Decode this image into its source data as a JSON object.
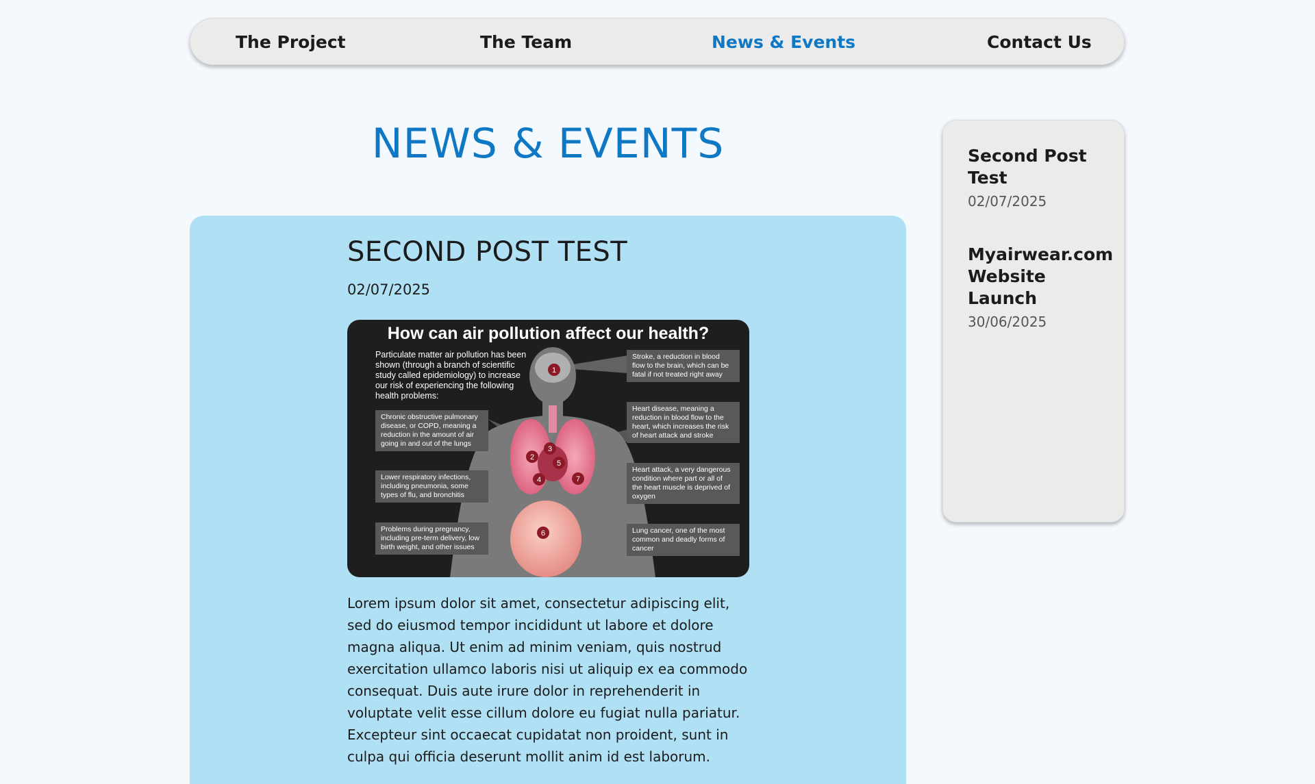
{
  "nav": {
    "items": [
      {
        "label": "The Project"
      },
      {
        "label": "The Team"
      },
      {
        "label": "News & Events"
      },
      {
        "label": "Contact Us"
      }
    ]
  },
  "page": {
    "title": "NEWS & EVENTS"
  },
  "post": {
    "title": "SECOND POST TEST",
    "date": "02/07/2025",
    "body": "Lorem ipsum dolor sit amet, consectetur adipiscing elit, sed do eiusmod tempor incididunt ut labore et dolore magna aliqua. Ut enim ad minim veniam, quis nostrud exercitation ullamco laboris nisi ut aliquip ex ea commodo consequat. Duis aute irure dolor in reprehenderit in voluptate velit esse cillum dolore eu fugiat nulla pariatur. Excepteur sint occaecat cupidatat non proident, sunt in culpa qui officia deserunt mollit anim id est laborum.",
    "image": {
      "title": "How can air pollution affect our health?",
      "intro": "Particulate matter air pollution has been shown (through a branch of scientific study called epidemiology) to increase our risk of experiencing the following health problems:",
      "left_boxes": [
        "Chronic obstructive pulmonary disease, or COPD, meaning a reduction in the amount of air going in and out of the lungs",
        "Lower respiratory infections, including pneumonia, some types of flu, and bronchitis",
        "Problems during pregnancy, including pre-term delivery, low birth weight, and other issues"
      ],
      "right_boxes": [
        "Stroke, a reduction in blood flow to the brain, which can be fatal if not treated right away",
        "Heart disease, meaning a reduction in blood flow to the heart, which increases the risk of heart attack and stroke",
        "Heart attack, a very dangerous condition where part or all of the heart muscle is deprived of oxygen",
        "Lung cancer, one of the most common and deadly forms of cancer"
      ],
      "markers": [
        "1",
        "2",
        "3",
        "4",
        "5",
        "6",
        "7"
      ]
    }
  },
  "sidebar": {
    "posts": [
      {
        "title": "Second Post Test",
        "date": "02/07/2025"
      },
      {
        "title": "Myairwear.com Website Launch",
        "date": "30/06/2025"
      }
    ]
  },
  "colors": {
    "accent": "#0f78c4",
    "card_bg": "#b0e0f4",
    "nav_bg": "#ebebeb",
    "page_bg": "#f4f9fd"
  }
}
